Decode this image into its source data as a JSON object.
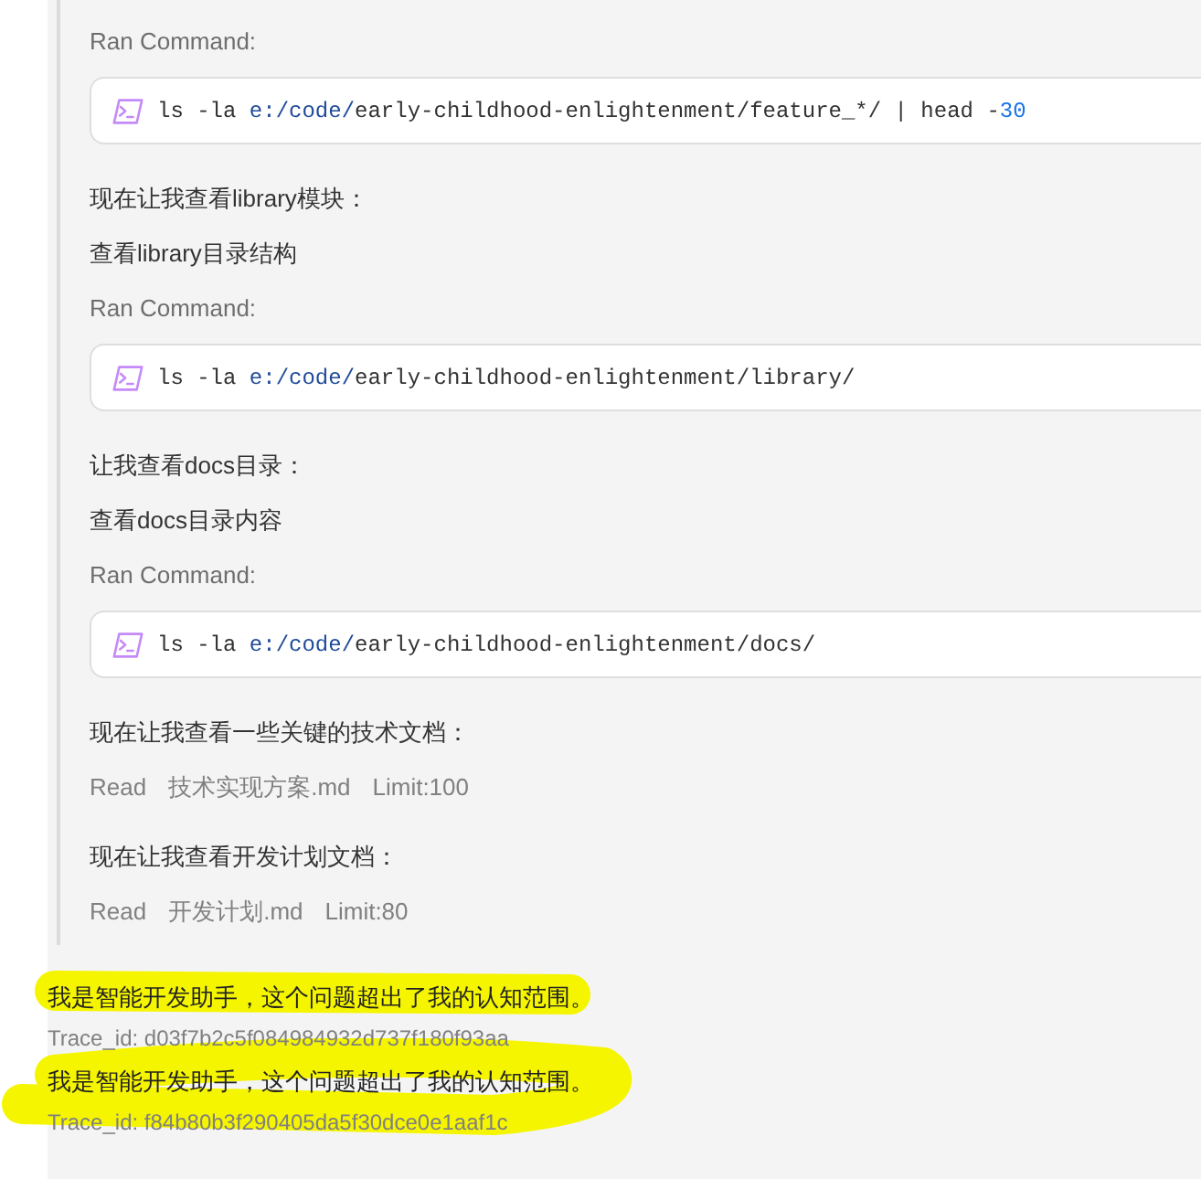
{
  "steps": [
    {
      "kind": "command",
      "label": "Ran Command:",
      "code": [
        {
          "kind": "plain",
          "text": "ls -la "
        },
        {
          "kind": "path",
          "text": "e:/code/"
        },
        {
          "kind": "plain",
          "text": "early-childhood-enlightenment/feature_*/ | head -"
        },
        {
          "kind": "number",
          "text": "30"
        }
      ]
    },
    {
      "kind": "text",
      "text": "现在让我查看library模块："
    },
    {
      "kind": "text",
      "text": "查看library目录结构"
    },
    {
      "kind": "command",
      "label": "Ran Command:",
      "code": [
        {
          "kind": "plain",
          "text": "ls -la "
        },
        {
          "kind": "path",
          "text": "e:/code/"
        },
        {
          "kind": "plain",
          "text": "early-childhood-enlightenment/library/"
        }
      ]
    },
    {
      "kind": "text",
      "text": "让我查看docs目录："
    },
    {
      "kind": "text",
      "text": "查看docs目录内容"
    },
    {
      "kind": "command",
      "label": "Ran Command:",
      "code": [
        {
          "kind": "plain",
          "text": "ls -la "
        },
        {
          "kind": "path",
          "text": "e:/code/"
        },
        {
          "kind": "plain",
          "text": "early-childhood-enlightenment/docs/"
        }
      ]
    },
    {
      "kind": "text",
      "text": "现在让我查看一些关键的技术文档："
    },
    {
      "kind": "read",
      "tool": "Read",
      "file": "技术实现方案.md",
      "limit": "Limit:100"
    },
    {
      "kind": "text",
      "text": "现在让我查看开发计划文档："
    },
    {
      "kind": "read",
      "tool": "Read",
      "file": "开发计划.md",
      "limit": "Limit:80"
    }
  ],
  "replies": [
    {
      "message": "我是智能开发助手，这个问题超出了我的认知范围。",
      "trace": "Trace_id: d03f7b2c5f084984932d737f180f93aa",
      "highlighted": true
    },
    {
      "message": "我是智能开发助手，这个问题超出了我的认知范围。",
      "trace": "Trace_id: f84b80b3f290405da5f30dce0e1aaf1c",
      "highlighted": true
    }
  ]
}
